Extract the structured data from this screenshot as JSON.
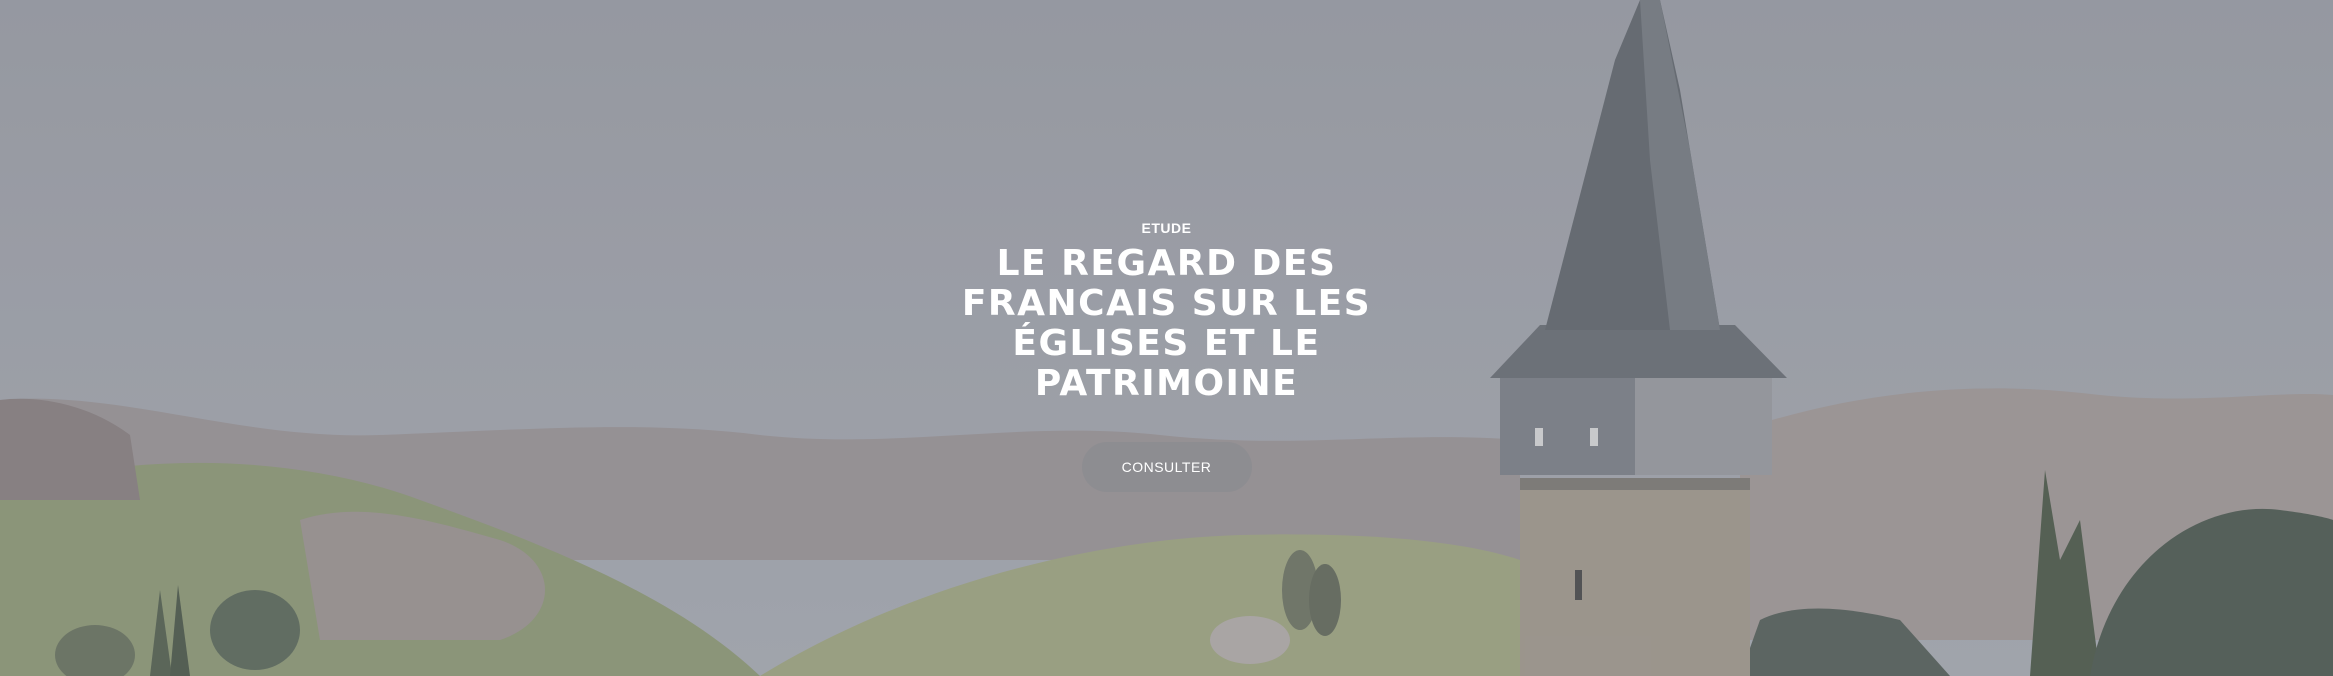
{
  "hero": {
    "kicker": "ETUDE",
    "title": "LE REGARD DES FRANCAIS SUR LES ÉGLISES ET LE PATRIMOINE",
    "button_label": "CONSULTER"
  },
  "colors": {
    "sky": "#9ba0a8",
    "hills": "#8d9a6e",
    "tower_stone": "#a39a8d",
    "spire": "#5f646a",
    "button": "#8c8c91"
  }
}
